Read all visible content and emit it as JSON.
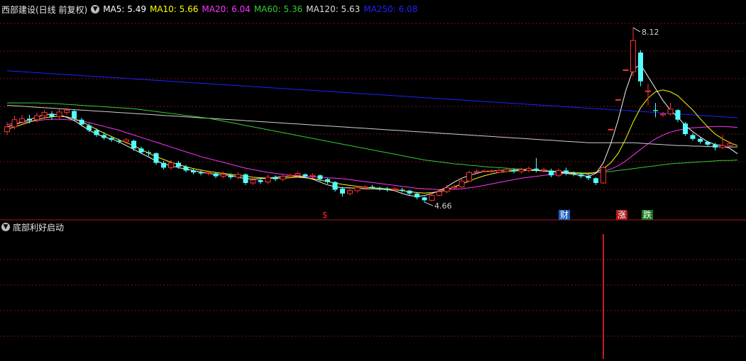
{
  "header": {
    "stock_title": "西部建设(日线 前复权)",
    "ma_items": [
      {
        "label": "MA5: 5.49",
        "color": "#ffffff"
      },
      {
        "label": "MA10: 5.66",
        "color": "#ffff00"
      },
      {
        "label": "MA20: 6.04",
        "color": "#ff33ff"
      },
      {
        "label": "MA60: 5.36",
        "color": "#33cc33"
      },
      {
        "label": "MA120: 5.63",
        "color": "#dddddd"
      },
      {
        "label": "MA250: 6.08",
        "color": "#2020ff"
      }
    ]
  },
  "indicator_pane": {
    "title": "底部利好启动"
  },
  "annotations": {
    "high_label": "8.12",
    "low_label": "4.66",
    "markers": [
      {
        "text": "$",
        "color": "#ff2020",
        "bg": "none"
      },
      {
        "text": "财",
        "color": "#ffffff",
        "bg": "#1f5fbf"
      },
      {
        "text": "涨",
        "color": "#ffffff",
        "bg": "#b01818"
      },
      {
        "text": "跌",
        "color": "#ffffff",
        "bg": "#1c7a1c"
      }
    ]
  },
  "colors": {
    "up": "#ff3232",
    "down": "#54ffff",
    "grid": "#7a1414",
    "background": "#000000"
  },
  "chart_data": {
    "type": "candlestick",
    "price_range": [
      4.2,
      8.4
    ],
    "candles": [
      [
        5.95,
        6.05,
        6.15,
        5.88
      ],
      [
        6.05,
        6.2,
        6.28,
        6.0
      ],
      [
        6.15,
        6.22,
        6.3,
        6.1
      ],
      [
        6.22,
        6.18,
        6.3,
        6.12
      ],
      [
        6.2,
        6.28,
        6.35,
        6.15
      ],
      [
        6.28,
        6.35,
        6.4,
        6.22
      ],
      [
        6.32,
        6.26,
        6.38,
        6.2
      ],
      [
        6.27,
        6.36,
        6.42,
        6.22
      ],
      [
        6.35,
        6.4,
        6.45,
        6.3
      ],
      [
        6.38,
        6.22,
        6.4,
        6.18
      ],
      [
        6.2,
        6.1,
        6.24,
        6.06
      ],
      [
        6.08,
        5.98,
        6.12,
        5.94
      ],
      [
        5.98,
        5.88,
        6.02,
        5.84
      ],
      [
        5.88,
        5.82,
        5.94,
        5.78
      ],
      [
        5.82,
        5.78,
        5.86,
        5.74
      ],
      [
        5.76,
        5.74,
        5.8,
        5.7
      ],
      [
        5.74,
        5.78,
        5.82,
        5.7
      ],
      [
        5.76,
        5.6,
        5.78,
        5.55
      ],
      [
        5.6,
        5.52,
        5.64,
        5.48
      ],
      [
        5.52,
        5.5,
        5.56,
        5.44
      ],
      [
        5.5,
        5.3,
        5.52,
        5.26
      ],
      [
        5.3,
        5.2,
        5.34,
        5.16
      ],
      [
        5.2,
        5.3,
        5.36,
        5.16
      ],
      [
        5.3,
        5.22,
        5.34,
        5.18
      ],
      [
        5.22,
        5.14,
        5.26,
        5.1
      ],
      [
        5.14,
        5.1,
        5.18,
        5.06
      ],
      [
        5.1,
        5.08,
        5.14,
        5.04
      ],
      [
        5.08,
        5.1,
        5.14,
        5.04
      ],
      [
        5.08,
        5.02,
        5.1,
        4.98
      ],
      [
        5.02,
        5.06,
        5.12,
        4.98
      ],
      [
        5.04,
        5.0,
        5.08,
        4.96
      ],
      [
        5.0,
        5.06,
        5.1,
        4.96
      ],
      [
        5.06,
        4.88,
        5.08,
        4.84
      ],
      [
        4.88,
        4.94,
        5.0,
        4.84
      ],
      [
        4.94,
        4.9,
        4.98,
        4.86
      ],
      [
        4.9,
        5.0,
        5.06,
        4.86
      ],
      [
        5.0,
        4.96,
        5.04,
        4.92
      ],
      [
        4.96,
        5.02,
        5.06,
        4.92
      ],
      [
        5.02,
        5.04,
        5.08,
        4.98
      ],
      [
        5.04,
        5.08,
        5.12,
        5.0
      ],
      [
        5.06,
        5.02,
        5.08,
        4.98
      ],
      [
        5.02,
        5.04,
        5.08,
        4.98
      ],
      [
        5.04,
        4.96,
        5.06,
        4.92
      ],
      [
        4.96,
        4.9,
        4.98,
        4.86
      ],
      [
        4.9,
        4.74,
        4.92,
        4.7
      ],
      [
        4.76,
        4.66,
        4.8,
        4.6
      ],
      [
        4.66,
        4.72,
        4.78,
        4.62
      ],
      [
        4.72,
        4.78,
        4.82,
        4.68
      ],
      [
        4.78,
        4.8,
        4.84,
        4.74
      ],
      [
        4.8,
        4.78,
        4.84,
        4.76
      ],
      [
        4.78,
        4.76,
        4.8,
        4.72
      ],
      [
        4.76,
        4.74,
        4.8,
        4.7
      ],
      [
        4.74,
        4.76,
        4.8,
        4.7
      ],
      [
        4.74,
        4.72,
        4.78,
        4.68
      ],
      [
        4.72,
        4.66,
        4.74,
        4.62
      ],
      [
        4.66,
        4.58,
        4.68,
        4.54
      ],
      [
        4.58,
        4.52,
        4.6,
        4.48
      ],
      [
        4.52,
        4.62,
        4.68,
        4.5
      ],
      [
        4.62,
        4.7,
        4.76,
        4.6
      ],
      [
        4.7,
        4.78,
        4.84,
        4.66
      ],
      [
        4.78,
        4.8,
        4.84,
        4.74
      ],
      [
        4.8,
        4.92,
        4.98,
        4.78
      ],
      [
        4.92,
        5.1,
        5.14,
        4.9
      ],
      [
        5.1,
        5.12,
        5.16,
        5.08
      ],
      [
        5.12,
        5.13,
        5.16,
        5.1
      ],
      [
        5.12,
        5.13,
        5.16,
        5.1
      ],
      [
        5.1,
        5.14,
        5.18,
        5.08
      ],
      [
        5.12,
        5.16,
        5.2,
        5.1
      ],
      [
        5.14,
        5.12,
        5.18,
        5.08
      ],
      [
        5.12,
        5.16,
        5.2,
        5.08
      ],
      [
        5.14,
        5.18,
        5.22,
        5.1
      ],
      [
        5.18,
        5.14,
        5.4,
        5.1
      ],
      [
        5.14,
        5.16,
        5.2,
        5.1
      ],
      [
        5.14,
        5.04,
        5.18,
        5.0
      ],
      [
        5.04,
        5.14,
        5.18,
        5.0
      ],
      [
        5.14,
        5.08,
        5.2,
        5.04
      ],
      [
        5.08,
        5.06,
        5.12,
        5.02
      ],
      [
        5.06,
        5.02,
        5.1,
        4.98
      ],
      [
        5.02,
        4.98,
        5.06,
        4.94
      ],
      [
        4.98,
        4.88,
        5.0,
        4.84
      ],
      [
        4.88,
        5.2,
        5.24,
        4.86
      ],
      [
        6.0,
        6.0,
        6.0,
        6.0
      ],
      [
        6.62,
        6.62,
        6.62,
        6.62
      ],
      [
        7.24,
        7.24,
        7.24,
        7.24
      ],
      [
        7.2,
        7.85,
        8.12,
        7.1
      ],
      [
        7.6,
        7.0,
        7.65,
        6.9
      ],
      [
        6.8,
        6.8,
        6.95,
        6.5
      ],
      [
        6.4,
        6.38,
        6.55,
        6.25
      ],
      [
        6.3,
        6.32,
        6.36,
        6.26
      ],
      [
        6.32,
        6.42,
        6.55,
        6.28
      ],
      [
        6.4,
        6.2,
        6.42,
        6.15
      ],
      [
        6.12,
        5.9,
        6.15,
        5.86
      ],
      [
        5.88,
        5.8,
        5.92,
        5.76
      ],
      [
        5.8,
        5.74,
        5.84,
        5.7
      ],
      [
        5.74,
        5.68,
        5.76,
        5.64
      ],
      [
        5.68,
        5.62,
        5.72,
        5.56
      ],
      [
        5.62,
        5.66,
        5.88,
        5.58
      ],
      [
        5.66,
        5.7,
        5.74,
        5.64
      ]
    ],
    "ma5": [
      6.05,
      6.1,
      6.15,
      6.2,
      6.26,
      6.3,
      6.32,
      6.3,
      6.25,
      6.18,
      6.08,
      5.98,
      5.9,
      5.84,
      5.8,
      5.74,
      5.66,
      5.58,
      5.5,
      5.42,
      5.34,
      5.28,
      5.24,
      5.2,
      5.17,
      5.14,
      5.11,
      5.08,
      5.06,
      5.05,
      5.04,
      5.0,
      4.97,
      4.96,
      4.97,
      4.98,
      5.0,
      5.01,
      5.02,
      5.02,
      5.0,
      4.96,
      4.9,
      4.84,
      4.8,
      4.78,
      4.78,
      4.77,
      4.76,
      4.76,
      4.75,
      4.74,
      4.72,
      4.66,
      4.62,
      4.6,
      4.62,
      4.66,
      4.72,
      4.8,
      4.9,
      4.98,
      5.04,
      5.08,
      5.12,
      5.13,
      5.14,
      5.15,
      5.15,
      5.16,
      5.16,
      5.15,
      5.13,
      5.12,
      5.1,
      5.08,
      5.06,
      5.04,
      5.02,
      5.08,
      5.3,
      5.7,
      6.2,
      6.8,
      7.25,
      7.35,
      7.1,
      6.85,
      6.6,
      6.4,
      6.25,
      6.08,
      5.95,
      5.84,
      5.74,
      5.68,
      5.66,
      5.6,
      5.49
    ],
    "ma10": [
      6.0,
      6.05,
      6.1,
      6.15,
      6.2,
      6.24,
      6.26,
      6.27,
      6.26,
      6.22,
      6.16,
      6.08,
      6.0,
      5.92,
      5.85,
      5.78,
      5.72,
      5.66,
      5.58,
      5.5,
      5.43,
      5.37,
      5.31,
      5.26,
      5.22,
      5.18,
      5.15,
      5.12,
      5.1,
      5.08,
      5.06,
      5.04,
      5.02,
      5.0,
      4.99,
      4.98,
      4.98,
      4.98,
      4.99,
      5.0,
      4.99,
      4.97,
      4.94,
      4.91,
      4.88,
      4.85,
      4.83,
      4.81,
      4.79,
      4.78,
      4.77,
      4.76,
      4.74,
      4.72,
      4.7,
      4.68,
      4.67,
      4.68,
      4.7,
      4.74,
      4.8,
      4.86,
      4.92,
      4.98,
      5.03,
      5.07,
      5.1,
      5.12,
      5.13,
      5.14,
      5.14,
      5.14,
      5.13,
      5.12,
      5.11,
      5.1,
      5.09,
      5.08,
      5.07,
      5.1,
      5.18,
      5.3,
      5.5,
      5.8,
      6.15,
      6.45,
      6.65,
      6.78,
      6.82,
      6.78,
      6.7,
      6.55,
      6.4,
      6.22,
      6.05,
      5.9,
      5.8,
      5.72,
      5.66
    ],
    "ma20": [
      6.1,
      6.12,
      6.14,
      6.16,
      6.18,
      6.2,
      6.21,
      6.21,
      6.2,
      6.19,
      6.17,
      6.14,
      6.1,
      6.06,
      6.02,
      5.98,
      5.93,
      5.88,
      5.83,
      5.78,
      5.73,
      5.68,
      5.63,
      5.58,
      5.53,
      5.48,
      5.43,
      5.39,
      5.35,
      5.31,
      5.27,
      5.23,
      5.19,
      5.16,
      5.13,
      5.1,
      5.08,
      5.06,
      5.04,
      5.03,
      5.02,
      5.01,
      5.0,
      4.99,
      4.98,
      4.97,
      4.95,
      4.93,
      4.91,
      4.89,
      4.87,
      4.85,
      4.83,
      4.81,
      4.79,
      4.77,
      4.76,
      4.75,
      4.74,
      4.74,
      4.75,
      4.76,
      4.78,
      4.8,
      4.83,
      4.86,
      4.89,
      4.92,
      4.95,
      4.98,
      5.0,
      5.02,
      5.04,
      5.06,
      5.07,
      5.08,
      5.08,
      5.08,
      5.08,
      5.09,
      5.12,
      5.17,
      5.24,
      5.34,
      5.46,
      5.58,
      5.7,
      5.8,
      5.88,
      5.94,
      5.98,
      6.01,
      6.03,
      6.04,
      6.05,
      6.06,
      6.06,
      6.05,
      6.04
    ],
    "ma60": [
      6.55,
      6.55,
      6.55,
      6.55,
      6.55,
      6.54,
      6.54,
      6.53,
      6.52,
      6.51,
      6.5,
      6.49,
      6.48,
      6.47,
      6.46,
      6.45,
      6.44,
      6.43,
      6.41,
      6.39,
      6.37,
      6.35,
      6.33,
      6.31,
      6.29,
      6.27,
      6.25,
      6.23,
      6.2,
      6.17,
      6.14,
      6.11,
      6.08,
      6.05,
      6.02,
      5.99,
      5.96,
      5.93,
      5.9,
      5.87,
      5.84,
      5.81,
      5.78,
      5.75,
      5.72,
      5.69,
      5.66,
      5.63,
      5.6,
      5.57,
      5.54,
      5.51,
      5.48,
      5.45,
      5.42,
      5.39,
      5.36,
      5.34,
      5.32,
      5.3,
      5.28,
      5.27,
      5.25,
      5.24,
      5.22,
      5.21,
      5.2,
      5.19,
      5.18,
      5.17,
      5.16,
      5.15,
      5.14,
      5.13,
      5.12,
      5.11,
      5.1,
      5.09,
      5.09,
      5.1,
      5.11,
      5.12,
      5.14,
      5.16,
      5.18,
      5.2,
      5.22,
      5.24,
      5.26,
      5.28,
      5.29,
      5.3,
      5.31,
      5.32,
      5.33,
      5.34,
      5.35,
      5.35,
      5.36
    ],
    "ma120": [
      6.5,
      6.49,
      6.48,
      6.47,
      6.46,
      6.45,
      6.44,
      6.43,
      6.42,
      6.41,
      6.4,
      6.39,
      6.38,
      6.37,
      6.36,
      6.35,
      6.34,
      6.33,
      6.32,
      6.31,
      6.3,
      6.29,
      6.28,
      6.27,
      6.26,
      6.25,
      6.24,
      6.23,
      6.22,
      6.21,
      6.2,
      6.19,
      6.18,
      6.17,
      6.16,
      6.15,
      6.14,
      6.13,
      6.12,
      6.11,
      6.1,
      6.09,
      6.08,
      6.07,
      6.06,
      6.05,
      6.04,
      6.03,
      6.02,
      6.01,
      6.0,
      5.99,
      5.98,
      5.97,
      5.96,
      5.95,
      5.94,
      5.93,
      5.92,
      5.91,
      5.9,
      5.89,
      5.88,
      5.87,
      5.86,
      5.85,
      5.84,
      5.83,
      5.82,
      5.81,
      5.8,
      5.79,
      5.78,
      5.77,
      5.76,
      5.75,
      5.74,
      5.73,
      5.72,
      5.72,
      5.72,
      5.72,
      5.72,
      5.72,
      5.72,
      5.71,
      5.7,
      5.69,
      5.68,
      5.67,
      5.66,
      5.66,
      5.65,
      5.65,
      5.64,
      5.64,
      5.63,
      5.63,
      5.63
    ],
    "ma250": [
      7.22,
      7.21,
      7.2,
      7.19,
      7.18,
      7.17,
      7.16,
      7.15,
      7.14,
      7.13,
      7.12,
      7.11,
      7.1,
      7.09,
      7.08,
      7.07,
      7.06,
      7.05,
      7.04,
      7.03,
      7.02,
      7.01,
      7.0,
      6.99,
      6.98,
      6.97,
      6.96,
      6.95,
      6.94,
      6.93,
      6.92,
      6.91,
      6.9,
      6.89,
      6.88,
      6.87,
      6.86,
      6.85,
      6.84,
      6.83,
      6.82,
      6.81,
      6.8,
      6.79,
      6.78,
      6.77,
      6.76,
      6.75,
      6.74,
      6.73,
      6.72,
      6.71,
      6.7,
      6.69,
      6.68,
      6.67,
      6.66,
      6.65,
      6.64,
      6.63,
      6.62,
      6.61,
      6.6,
      6.59,
      6.58,
      6.57,
      6.56,
      6.55,
      6.54,
      6.53,
      6.52,
      6.51,
      6.5,
      6.49,
      6.48,
      6.47,
      6.46,
      6.45,
      6.44,
      6.43,
      6.42,
      6.41,
      6.4,
      6.39,
      6.38,
      6.37,
      6.36,
      6.35,
      6.34,
      6.33,
      6.32,
      6.31,
      6.3,
      6.29,
      6.28,
      6.27,
      6.26,
      6.25,
      6.24
    ],
    "indicator_signal_index": 80
  }
}
